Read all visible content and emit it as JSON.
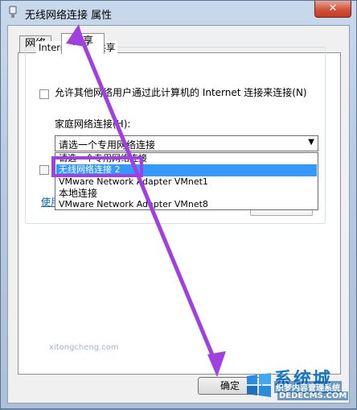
{
  "window": {
    "title": "无线网络连接 属性",
    "close_label": "✕"
  },
  "tabs": [
    {
      "label": "网络"
    },
    {
      "label": "共享"
    }
  ],
  "sharing": {
    "group_label": "Internet 连接共享",
    "allow_text": "允许其他网络用户通过此计算机的 Internet 连接来连接(N)",
    "allow_checked": false,
    "home_label": "家庭网络连接(H):",
    "combo_value": "请选一个专用网络连接",
    "dropdown_items": [
      "请选一个专用网络连接",
      "无线网络连接 2",
      "VMware Network Adapter VMnet1",
      "本地连接",
      "VMware Network Adapter VMnet8"
    ],
    "selected_index": 1,
    "link_text": "使用",
    "ok_label": "确定"
  },
  "watermark": {
    "brand": "系统城",
    "line1": "织梦内容管理系统",
    "line2": "DEDECMS.COM",
    "url": "xitongcheng.com"
  },
  "colors": {
    "highlight": "#3399ff",
    "annotation": "#a040e0"
  }
}
